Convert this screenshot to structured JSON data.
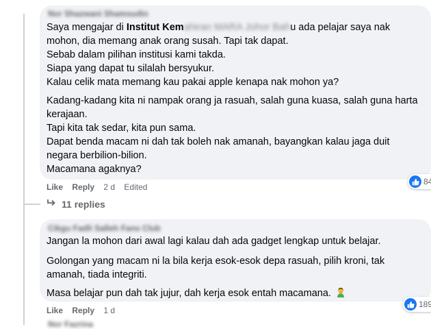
{
  "comment1": {
    "author": "Nor Shazwani Shamsudin",
    "line1": {
      "before": "Saya mengajar di ",
      "bold": "Institut Kem",
      "blurred": "ahiran MARA Johor Bah",
      "after": "u ada pelajar saya nak"
    },
    "p1_lines": [
      "mohon, dia memang anak orang susah. Tapi tak dapat.",
      "Sebab dalam pilihan institusi kami takda.",
      "Siapa yang dapat tu silalah bersyukur.",
      "Kalau celik mata memang kau pakai apple kenapa nak mohon ya?"
    ],
    "p2_lines": [
      "Kadang-kadang kita ni nampak orang ja rasuah, salah guna kuasa, salah guna harta",
      "kerajaan.",
      "Tapi kita tak sedar, kita pun sama.",
      "Dapat benda macam ni dah tak boleh nak amanah, bayangkan kalau jaga duit",
      "negara berbilion-bilion.",
      "Macamana agaknya?"
    ],
    "actions": {
      "like": "Like",
      "reply": "Reply",
      "time": "2 d",
      "edited": "Edited"
    },
    "reaction_count": "84",
    "replies_label": "11 replies"
  },
  "comment2": {
    "author": "Cikgu Fadli Salleh Fans Club",
    "p1": "Jangan la mohon dari awal lagi kalau dah ada gadget lengkap untuk belajar.",
    "p2_lines": [
      "Golongan yang macam ni la bila kerja esok-esok depa rasuah, pilih kroni, tak",
      "amanah, tiada integriti."
    ],
    "p3": "Masa belajar pun dah tak jujur, dah kerja esok entah macamana.",
    "emoji_name": "man-facepalming-emoji",
    "actions": {
      "like": "Like",
      "reply": "Reply",
      "time": "1 d"
    },
    "reaction_count": "189"
  },
  "bottom_author": "Nor Fazrina"
}
